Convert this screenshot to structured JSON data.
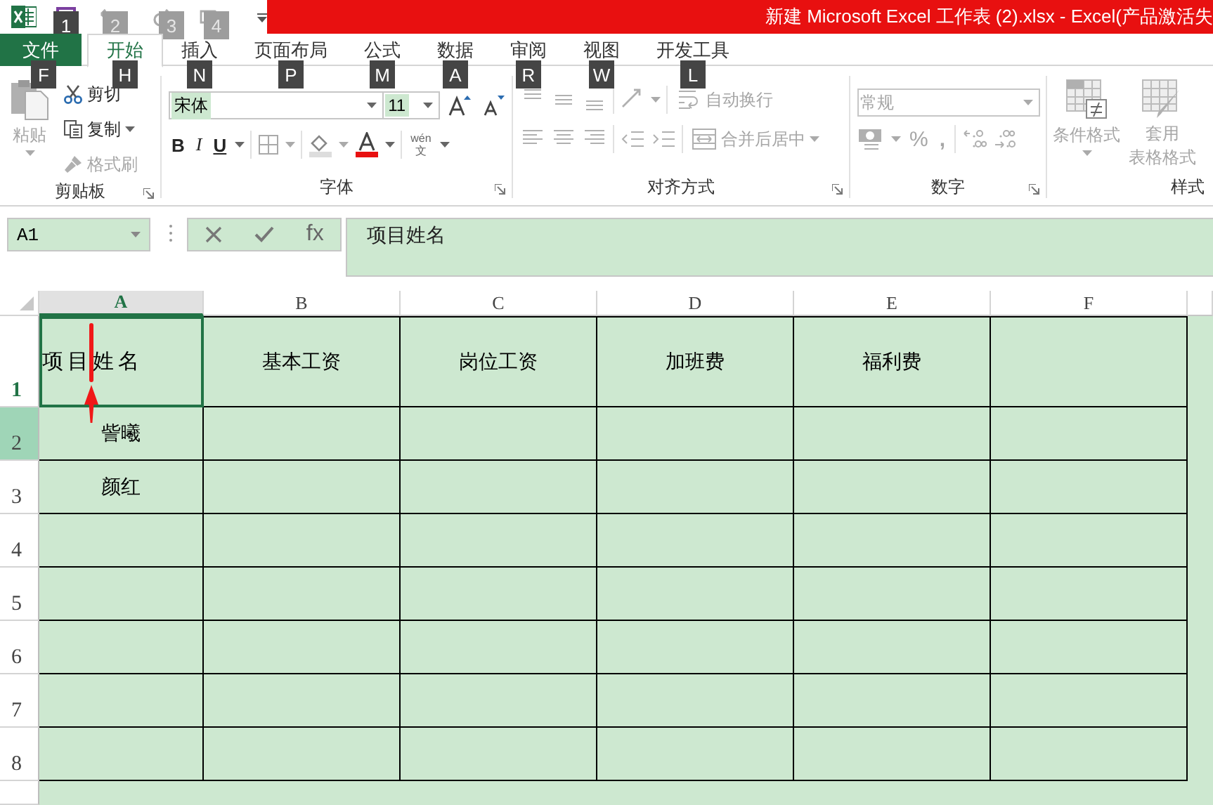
{
  "title_bar": {
    "title": "新建 Microsoft Excel 工作表 (2).xlsx -  Excel(产品激活失",
    "keytips": [
      {
        "text": "1",
        "disabled": false
      },
      {
        "text": "2",
        "disabled": true
      },
      {
        "text": "3",
        "disabled": true
      },
      {
        "text": "4",
        "disabled": true
      }
    ]
  },
  "tabs": [
    {
      "label": "文件",
      "keytip": "F",
      "kind": "file",
      "selected": false
    },
    {
      "label": "开始",
      "keytip": "H",
      "kind": "tab",
      "selected": true
    },
    {
      "label": "插入",
      "keytip": "N",
      "kind": "tab",
      "selected": false
    },
    {
      "label": "页面布局",
      "keytip": "P",
      "kind": "tab",
      "selected": false
    },
    {
      "label": "公式",
      "keytip": "M",
      "kind": "tab",
      "selected": false
    },
    {
      "label": "数据",
      "keytip": "A",
      "kind": "tab",
      "selected": false
    },
    {
      "label": "审阅",
      "keytip": "R",
      "kind": "tab",
      "selected": false
    },
    {
      "label": "视图",
      "keytip": "W",
      "kind": "tab",
      "selected": false
    },
    {
      "label": "开发工具",
      "keytip": "L",
      "kind": "tab",
      "selected": false
    }
  ],
  "ribbon": {
    "clipboard": {
      "label": "剪贴板",
      "paste": {
        "text": "粘贴",
        "disabled": true
      },
      "cut": {
        "text": "剪切",
        "disabled": false
      },
      "copy": {
        "text": "复制",
        "disabled": false
      },
      "format_painter": {
        "text": "格式刷",
        "disabled": true
      }
    },
    "font": {
      "label": "字体",
      "font_name": "宋体",
      "font_size": "11",
      "bold": "B",
      "italic": "I",
      "underline": "U",
      "phonetic_top": "wén",
      "phonetic_bottom": "文"
    },
    "alignment": {
      "label": "对齐方式",
      "disabled": true,
      "wrap_text": "自动换行",
      "merge_center": "合并后居中"
    },
    "number": {
      "label": "数字",
      "disabled": true,
      "format": "常规",
      "percent": "%",
      "comma": ","
    },
    "styles": {
      "label": "样式",
      "disabled": true,
      "conditional_formatting": "条件格式",
      "format_as_table": [
        "套用",
        "表格格式"
      ]
    }
  },
  "formula_bar": {
    "name_box": "A1",
    "insert_function": "fx",
    "formula": "项目姓名"
  },
  "sheet": {
    "columns": [
      {
        "label": "A",
        "selected": true
      },
      {
        "label": "B",
        "selected": false
      },
      {
        "label": "C",
        "selected": false
      },
      {
        "label": "D",
        "selected": false
      },
      {
        "label": "E",
        "selected": false
      },
      {
        "label": "F",
        "selected": false
      }
    ],
    "rows": [
      {
        "label": "1",
        "selected": true,
        "highlighted": false,
        "cells": [
          "项目姓名",
          "基本工资",
          "岗位工资",
          "加班费",
          "福利费"
        ]
      },
      {
        "label": "2",
        "selected": false,
        "highlighted": true,
        "cells": [
          "訾曦"
        ]
      },
      {
        "label": "3",
        "selected": false,
        "highlighted": false,
        "cells": [
          "颜红"
        ]
      },
      {
        "label": "4",
        "selected": false,
        "highlighted": false
      },
      {
        "label": "5",
        "selected": false,
        "highlighted": false
      },
      {
        "label": "6",
        "selected": false,
        "highlighted": false
      },
      {
        "label": "7",
        "selected": false,
        "highlighted": false
      },
      {
        "label": "8",
        "selected": false,
        "highlighted": false
      }
    ]
  }
}
